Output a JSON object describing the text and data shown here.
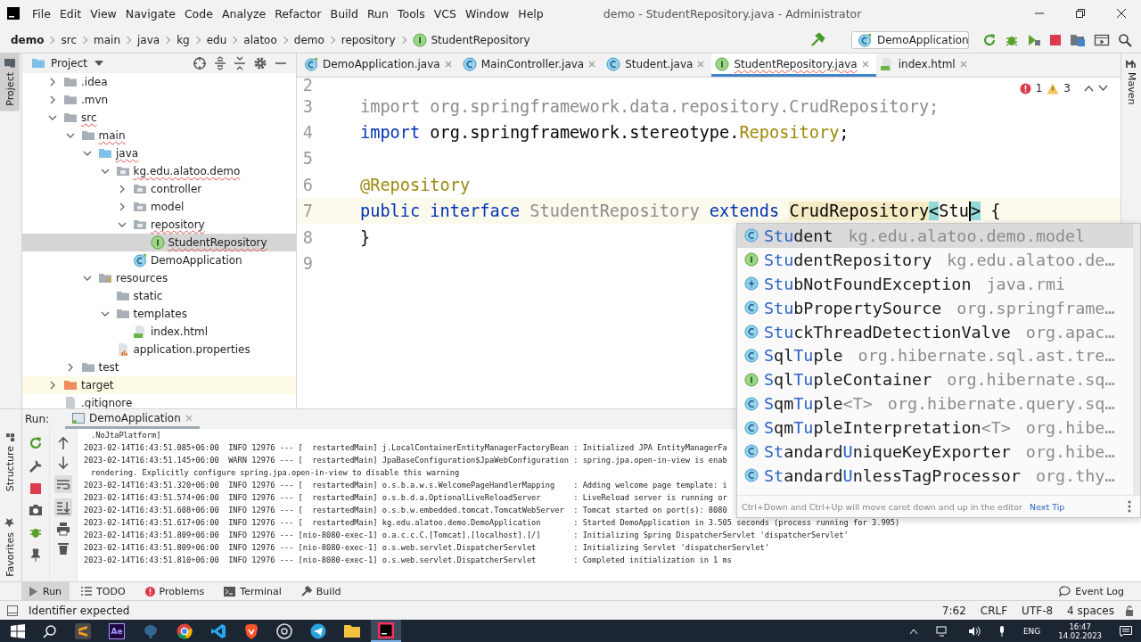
{
  "window": {
    "title": "demo - StudentRepository.java - Administrator"
  },
  "menu": [
    "File",
    "Edit",
    "View",
    "Navigate",
    "Code",
    "Analyze",
    "Refactor",
    "Build",
    "Run",
    "Tools",
    "VCS",
    "Window",
    "Help"
  ],
  "breadcrumbs": [
    {
      "label": "demo",
      "kind": "project"
    },
    {
      "label": "src",
      "kind": "dir"
    },
    {
      "label": "main",
      "kind": "dir"
    },
    {
      "label": "java",
      "kind": "dir"
    },
    {
      "label": "kg",
      "kind": "dir"
    },
    {
      "label": "edu",
      "kind": "dir"
    },
    {
      "label": "alatoo",
      "kind": "dir"
    },
    {
      "label": "demo",
      "kind": "dir"
    },
    {
      "label": "repository",
      "kind": "dir"
    },
    {
      "label": "StudentRepository",
      "kind": "interface"
    }
  ],
  "run_config": {
    "label": "DemoApplication"
  },
  "side_labels": {
    "project": "Project",
    "structure": "Structure",
    "favorites": "Favorites",
    "maven": "Maven"
  },
  "project_panel": {
    "title": "Project",
    "tree": [
      {
        "label": ".idea",
        "kind": "folder",
        "expanded": false,
        "selected": false,
        "misspelled": false
      },
      {
        "label": ".mvn",
        "kind": "folder",
        "expanded": false,
        "selected": false,
        "misspelled": false
      },
      {
        "label": "src",
        "kind": "folder",
        "expanded": true,
        "selected": false,
        "misspelled": true,
        "children": [
          {
            "label": "main",
            "kind": "folder",
            "expanded": true,
            "selected": false,
            "misspelled": true,
            "children": [
              {
                "label": "java",
                "kind": "source-folder",
                "expanded": true,
                "selected": false,
                "misspelled": true,
                "children": [
                  {
                    "label": "kg.edu.alatoo.demo",
                    "kind": "package",
                    "expanded": true,
                    "selected": false,
                    "misspelled": true,
                    "children": [
                      {
                        "label": "controller",
                        "kind": "package",
                        "expanded": false,
                        "selected": false,
                        "misspelled": false
                      },
                      {
                        "label": "model",
                        "kind": "package",
                        "expanded": false,
                        "selected": false,
                        "misspelled": false
                      },
                      {
                        "label": "repository",
                        "kind": "package",
                        "expanded": true,
                        "selected": false,
                        "misspelled": true,
                        "children": [
                          {
                            "label": "StudentRepository",
                            "kind": "interface",
                            "selected": true,
                            "misspelled": true
                          }
                        ]
                      },
                      {
                        "label": "DemoApplication",
                        "kind": "spring-class",
                        "selected": false,
                        "misspelled": false
                      }
                    ]
                  }
                ]
              },
              {
                "label": "resources",
                "kind": "resources",
                "expanded": true,
                "selected": false,
                "misspelled": false,
                "children": [
                  {
                    "label": "static",
                    "kind": "folder",
                    "selected": false,
                    "misspelled": false
                  },
                  {
                    "label": "templates",
                    "kind": "folder",
                    "expanded": true,
                    "selected": false,
                    "misspelled": false,
                    "children": [
                      {
                        "label": "index.html",
                        "kind": "html",
                        "selected": false,
                        "misspelled": false
                      }
                    ]
                  },
                  {
                    "label": "application.properties",
                    "kind": "properties",
                    "selected": false,
                    "misspelled": false
                  }
                ]
              }
            ]
          },
          {
            "label": "test",
            "kind": "folder",
            "expanded": false,
            "selected": false,
            "misspelled": false
          }
        ]
      },
      {
        "label": "target",
        "kind": "excluded-folder",
        "expanded": false,
        "selected": false,
        "misspelled": false
      },
      {
        "label": ".gitignore",
        "kind": "file",
        "selected": false,
        "misspelled": false
      }
    ]
  },
  "editor": {
    "tabs": [
      {
        "label": "DemoApplication.java",
        "kind": "spring-class",
        "selected": false
      },
      {
        "label": "MainController.java",
        "kind": "class",
        "selected": false
      },
      {
        "label": "Student.java",
        "kind": "class",
        "selected": false
      },
      {
        "label": "StudentRepository.java",
        "kind": "interface",
        "selected": true
      },
      {
        "label": "index.html",
        "kind": "html",
        "selected": false
      }
    ],
    "inspections": {
      "errors": "1",
      "warnings": "3"
    },
    "lines": [
      {
        "number": "2",
        "current": false
      },
      {
        "number": "3",
        "current": false,
        "tokens": [
          {
            "kind": "unused",
            "text": "import org.springframework.data.repository.CrudRepository;"
          }
        ]
      },
      {
        "number": "4",
        "current": false,
        "tokens": [
          {
            "kind": "keyword",
            "text": "import"
          },
          {
            "kind": "plain",
            "text": " org.springframework.stereotype."
          },
          {
            "kind": "annotation",
            "text": "Repository"
          },
          {
            "kind": "plain",
            "text": ";"
          }
        ]
      },
      {
        "number": "5",
        "current": false
      },
      {
        "number": "6",
        "current": false,
        "tokens": [
          {
            "kind": "annotation",
            "text": "@Repository"
          }
        ]
      },
      {
        "number": "7",
        "current": true,
        "tokens": [
          {
            "kind": "keyword",
            "text": "public"
          },
          {
            "kind": "keyword",
            "text": " interface"
          },
          {
            "kind": "unused",
            "text": " StudentRepository"
          },
          {
            "kind": "keyword",
            "text": " extends "
          },
          {
            "kind": "type-highlight",
            "text": "CrudRepository"
          },
          {
            "kind": "brace",
            "text": "<"
          },
          {
            "kind": "plain",
            "text": "Stu"
          },
          {
            "kind": "caret"
          },
          {
            "kind": "brace",
            "text": ">"
          },
          {
            "kind": "plain",
            "text": " {"
          }
        ]
      },
      {
        "number": "8",
        "current": false,
        "tokens": [
          {
            "kind": "plain",
            "text": "}"
          }
        ]
      },
      {
        "number": "9",
        "current": false
      }
    ]
  },
  "completion": {
    "items": [
      {
        "kind": "class",
        "selected": true,
        "parts": [
          {
            "text": "Stu",
            "match": true
          },
          {
            "text": "dent",
            "match": false
          }
        ],
        "package": "kg.edu.alatoo.demo.model"
      },
      {
        "kind": "interface",
        "selected": false,
        "parts": [
          {
            "text": "Stu",
            "match": true
          },
          {
            "text": "dentRepository",
            "match": false
          }
        ],
        "package": "kg.edu.alatoo.de…"
      },
      {
        "kind": "exception",
        "selected": false,
        "parts": [
          {
            "text": "Stu",
            "match": true
          },
          {
            "text": "bNotFoundException",
            "match": false
          }
        ],
        "package": "java.rmi"
      },
      {
        "kind": "class",
        "selected": false,
        "parts": [
          {
            "text": "Stu",
            "match": true
          },
          {
            "text": "bPropertySource",
            "match": false
          }
        ],
        "package": "org.springframe…"
      },
      {
        "kind": "class",
        "selected": false,
        "parts": [
          {
            "text": "Stu",
            "match": true
          },
          {
            "text": "ckThreadDetectionValve",
            "match": false
          }
        ],
        "package": "org.apac…"
      },
      {
        "kind": "class",
        "selected": false,
        "parts": [
          {
            "text": "S",
            "match": true
          },
          {
            "text": "ql",
            "match": false
          },
          {
            "text": "Tu",
            "match": true
          },
          {
            "text": "ple",
            "match": false
          }
        ],
        "package": "org.hibernate.sql.ast.tre…"
      },
      {
        "kind": "interface",
        "selected": false,
        "parts": [
          {
            "text": "S",
            "match": true
          },
          {
            "text": "ql",
            "match": false
          },
          {
            "text": "Tu",
            "match": true
          },
          {
            "text": "pleContainer",
            "match": false
          }
        ],
        "package": "org.hibernate.sq…"
      },
      {
        "kind": "class",
        "selected": false,
        "parts": [
          {
            "text": "S",
            "match": true
          },
          {
            "text": "qm",
            "match": false
          },
          {
            "text": "Tu",
            "match": true
          },
          {
            "text": "ple",
            "match": false
          }
        ],
        "type_params": "<T>",
        "package": "org.hibernate.query.sq…"
      },
      {
        "kind": "class",
        "selected": false,
        "parts": [
          {
            "text": "S",
            "match": true
          },
          {
            "text": "qm",
            "match": false
          },
          {
            "text": "Tu",
            "match": true
          },
          {
            "text": "pleInterpretation",
            "match": false
          }
        ],
        "type_params": "<T>",
        "package": "org.hibe…"
      },
      {
        "kind": "class",
        "selected": false,
        "parts": [
          {
            "text": "St",
            "match": true
          },
          {
            "text": "andard",
            "match": false
          },
          {
            "text": "U",
            "match": true
          },
          {
            "text": "niqueKeyExporter",
            "match": false
          }
        ],
        "package": "org.hibe…"
      },
      {
        "kind": "class",
        "selected": false,
        "parts": [
          {
            "text": "St",
            "match": true
          },
          {
            "text": "andard",
            "match": false
          },
          {
            "text": "U",
            "match": true
          },
          {
            "text": "nlessTagProcessor",
            "match": false
          }
        ],
        "package": "org.thy…"
      }
    ],
    "tip": "Ctrl+Down and Ctrl+Up will move caret down and up in the editor",
    "tip_link": "Next Tip"
  },
  "run_panel": {
    "label": "Run:",
    "tab": "DemoApplication",
    "console": [
      {
        "kind": "continuation",
        "text": ".NoJtaPlatform]"
      },
      {
        "kind": "log",
        "text": "2023-02-14T16:43:51.085+06:00  INFO 12976 --- [  restartedMain] j.LocalContainerEntityManagerFactoryBean : Initialized JPA EntityManagerFa"
      },
      {
        "kind": "log",
        "text": "2023-02-14T16:43:51.145+06:00  WARN 12976 --- [  restartedMain] JpaBaseConfiguration$JpaWebConfiguration : spring.jpa.open-in-view is enab"
      },
      {
        "kind": "continuation",
        "text": "rendering. Explicitly configure spring.jpa.open-in-view to disable this warning"
      },
      {
        "kind": "log",
        "text": "2023-02-14T16:43:51.320+06:00  INFO 12976 --- [  restartedMain] o.s.b.a.w.s.WelcomePageHandlerMapping    : Adding welcome page template: i"
      },
      {
        "kind": "log",
        "text": "2023-02-14T16:43:51.574+06:00  INFO 12976 --- [  restartedMain] o.s.b.d.a.OptionalLiveReloadServer       : LiveReload server is running or"
      },
      {
        "kind": "log",
        "text": "2023-02-14T16:43:51.608+06:00  INFO 12976 --- [  restartedMain] o.s.b.w.embedded.tomcat.TomcatWebServer  : Tomcat started on port(s): 8080"
      },
      {
        "kind": "log",
        "text": "2023-02-14T16:43:51.617+06:00  INFO 12976 --- [  restartedMain] kg.edu.alatoo.demo.DemoApplication       : Started DemoApplication in 3.505 seconds (process running for 3.995)"
      },
      {
        "kind": "log",
        "text": "2023-02-14T16:43:51.809+06:00  INFO 12976 --- [nio-8080-exec-1] o.a.c.c.C.[Tomcat].[localhost].[/]       : Initializing Spring DispatcherServlet 'dispatcherServlet'"
      },
      {
        "kind": "log",
        "text": "2023-02-14T16:43:51.809+06:00  INFO 12976 --- [nio-8080-exec-1] o.s.web.servlet.DispatcherServlet        : Initializing Servlet 'dispatcherServlet'"
      },
      {
        "kind": "log",
        "text": "2023-02-14T16:43:51.810+06:00  INFO 12976 --- [nio-8080-exec-1] o.s.web.servlet.DispatcherServlet        : Completed initialization in 1 ms"
      }
    ]
  },
  "tool_windows": [
    {
      "label": "Run",
      "kind": "run",
      "selected": true
    },
    {
      "label": "TODO",
      "kind": "todo",
      "selected": false
    },
    {
      "label": "Problems",
      "kind": "problems",
      "selected": false
    },
    {
      "label": "Terminal",
      "kind": "terminal",
      "selected": false
    },
    {
      "label": "Build",
      "kind": "build",
      "selected": false
    }
  ],
  "event_log": "Event Log",
  "status": {
    "message": "Identifier expected",
    "items": [
      "7:62",
      "CRLF",
      "UTF-8",
      "4 spaces"
    ]
  },
  "taskbar": {
    "app_badge": "Ae",
    "language": "ENG",
    "time": "16:47",
    "date": "14.02.2023"
  }
}
